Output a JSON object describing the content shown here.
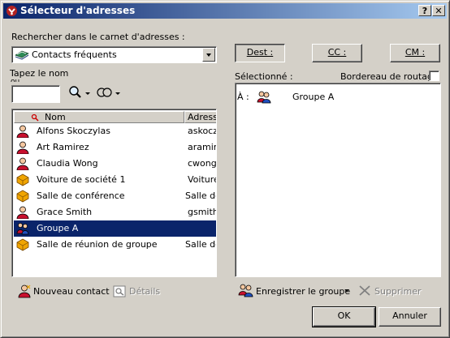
{
  "window": {
    "title": "Sélecteur d'adresses",
    "help_label": "?",
    "close_label": "✕"
  },
  "search": {
    "label": "Rechercher dans le carnet d'adresses :",
    "book_selected": "Contacts fréquents",
    "type_name_label": "Tapez le nom",
    "type_name_hidden": "ou",
    "name_value": ""
  },
  "list": {
    "columns": [
      "Nom",
      "Adresse"
    ],
    "rows": [
      {
        "name": "Alfons Skoczylas",
        "address": "askoczy",
        "kind": "contact"
      },
      {
        "name": "Art Ramirez",
        "address": "aramire",
        "kind": "contact"
      },
      {
        "name": "Claudia Wong",
        "address": "cwong@",
        "kind": "contact"
      },
      {
        "name": "Voiture de société 1",
        "address": "Voiture",
        "kind": "resource"
      },
      {
        "name": "Salle de conférence",
        "address": "Salle de",
        "kind": "resource"
      },
      {
        "name": "Grace Smith",
        "address": "gsmith@",
        "kind": "contact"
      },
      {
        "name": "Groupe A",
        "address": "",
        "kind": "group",
        "selected": true
      },
      {
        "name": "Salle de réunion de groupe",
        "address": "Salle de",
        "kind": "resource"
      }
    ]
  },
  "buttons": {
    "dest": "Dest :",
    "cc": "CC :",
    "cm": "CM :",
    "new_contact": "Nouveau contact",
    "details": "Détails",
    "save_group": "Enregistrer le groupe",
    "delete": "Supprimer",
    "ok": "OK",
    "cancel": "Annuler"
  },
  "selected": {
    "label": "Sélectionné :",
    "routing_label": "Bordereau de routage",
    "routing_checked": false,
    "items": [
      {
        "prefix": "À :",
        "name": "Groupe A"
      }
    ]
  },
  "colors": {
    "selection": "#0a246a",
    "face": "#d4d0c8"
  }
}
